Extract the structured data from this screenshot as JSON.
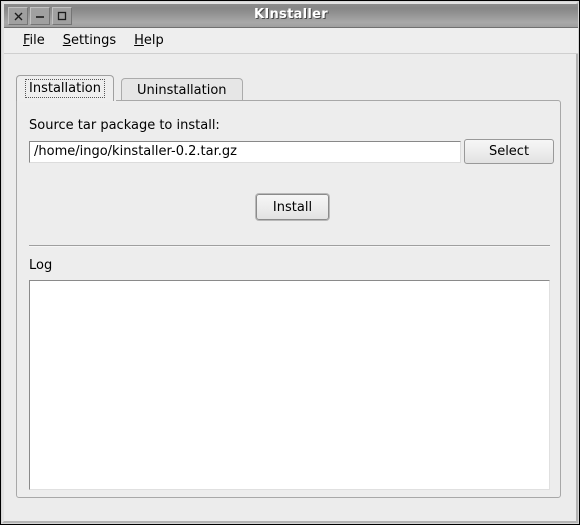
{
  "window": {
    "title": "KInstaller",
    "titlebar_buttons": [
      {
        "name": "close",
        "glyph": "✕"
      },
      {
        "name": "minimize",
        "glyph": "–"
      },
      {
        "name": "maximize",
        "glyph": "□"
      }
    ]
  },
  "menubar": {
    "items": [
      {
        "mnemonic": "F",
        "rest": "ile"
      },
      {
        "mnemonic": "S",
        "rest": "ettings"
      },
      {
        "mnemonic": "H",
        "rest": "elp"
      }
    ]
  },
  "tabs": [
    {
      "label": "Installation",
      "selected": true
    },
    {
      "label": "Uninstallation",
      "selected": false
    }
  ],
  "installation": {
    "source_label": "Source tar package to install:",
    "path_value": "/home/ingo/kinstaller-0.2.tar.gz",
    "path_placeholder": "",
    "select_label": "Select",
    "install_label": "Install",
    "log_label": "Log",
    "log_value": "",
    "log_placeholder": ""
  },
  "colors": {
    "window_bg": "#ececec",
    "panel_bg": "#ededed",
    "titlebar_gray": "#9a9a9a",
    "field_white": "#ffffff",
    "border_gray": "#a8a8a8"
  }
}
